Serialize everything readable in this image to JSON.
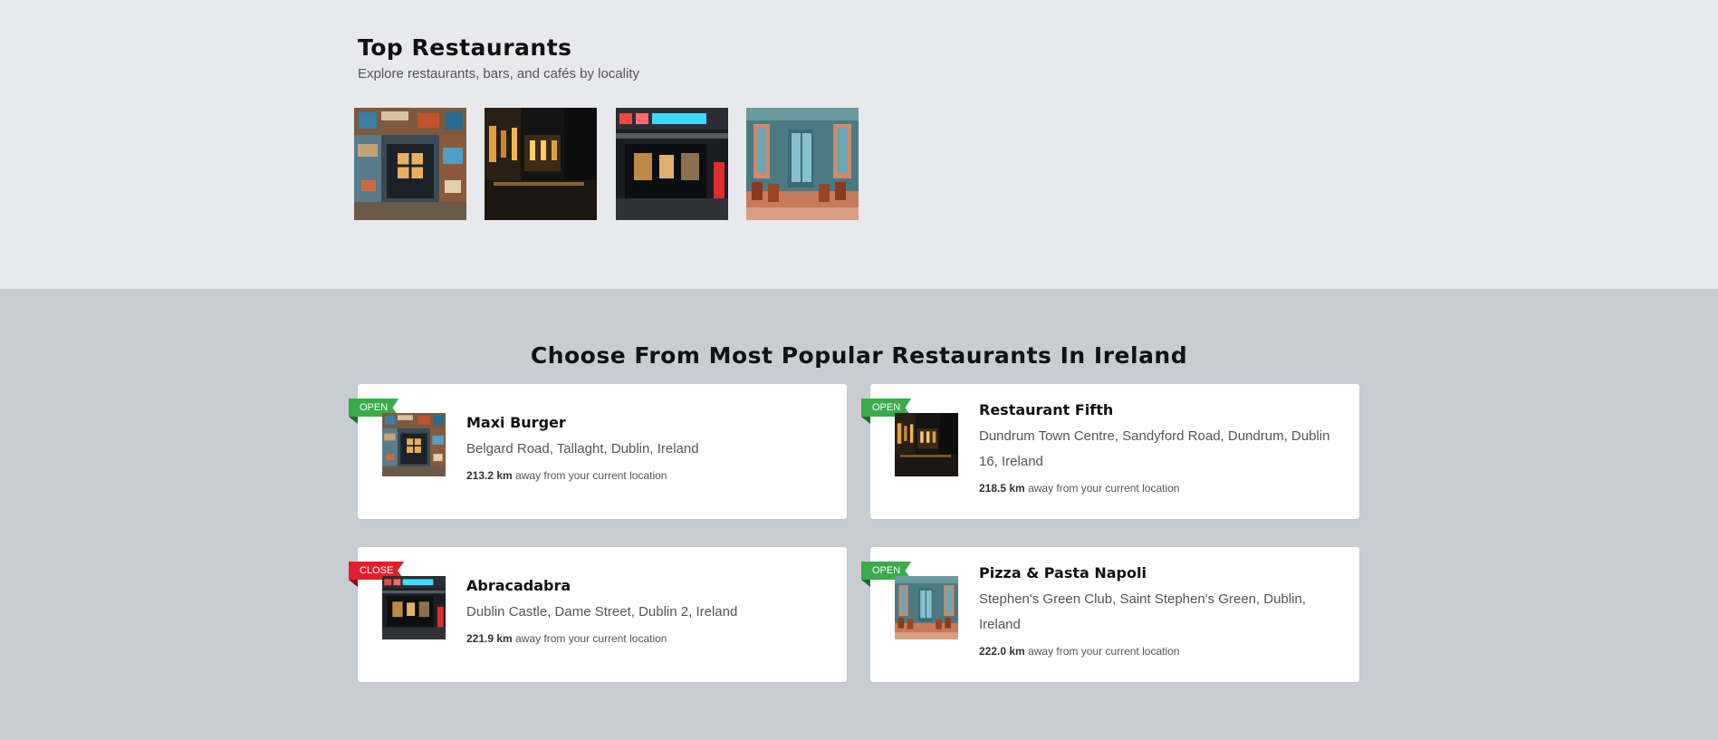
{
  "top_restaurants": {
    "title": "Top Restaurants",
    "subtitle": "Explore restaurants, bars, and cafés by locality",
    "thumbnails": [
      {
        "name": "colorful-storefront"
      },
      {
        "name": "dark-bar-interior"
      },
      {
        "name": "neon-bar-entrance"
      },
      {
        "name": "blue-cafe-terrace"
      }
    ]
  },
  "popular": {
    "title": "Choose From Most Popular Restaurants In Ireland",
    "distance_suffix": "away from your current location",
    "restaurants": [
      {
        "status": "OPEN",
        "name": "Maxi Burger",
        "address": "Belgard Road, Tallaght, Dublin, Ireland",
        "distance": "213.2 km"
      },
      {
        "status": "OPEN",
        "name": "Restaurant Fifth",
        "address": "Dundrum Town Centre, Sandyford Road, Dundrum, Dublin 16, Ireland",
        "distance": "218.5 km"
      },
      {
        "status": "CLOSE",
        "name": "Abracadabra",
        "address": "Dublin Castle, Dame Street, Dublin 2, Ireland",
        "distance": "221.9 km"
      },
      {
        "status": "OPEN",
        "name": "Pizza & Pasta Napoli",
        "address": "Stephen's Green Club, Saint Stephen's Green, Dublin, Ireland",
        "distance": "222.0 km"
      }
    ]
  },
  "colors": {
    "open": "#3aaa4a",
    "close": "#e0202b",
    "top_bg": "#e8e9ec",
    "bottom_bg": "#c8cdd4"
  }
}
